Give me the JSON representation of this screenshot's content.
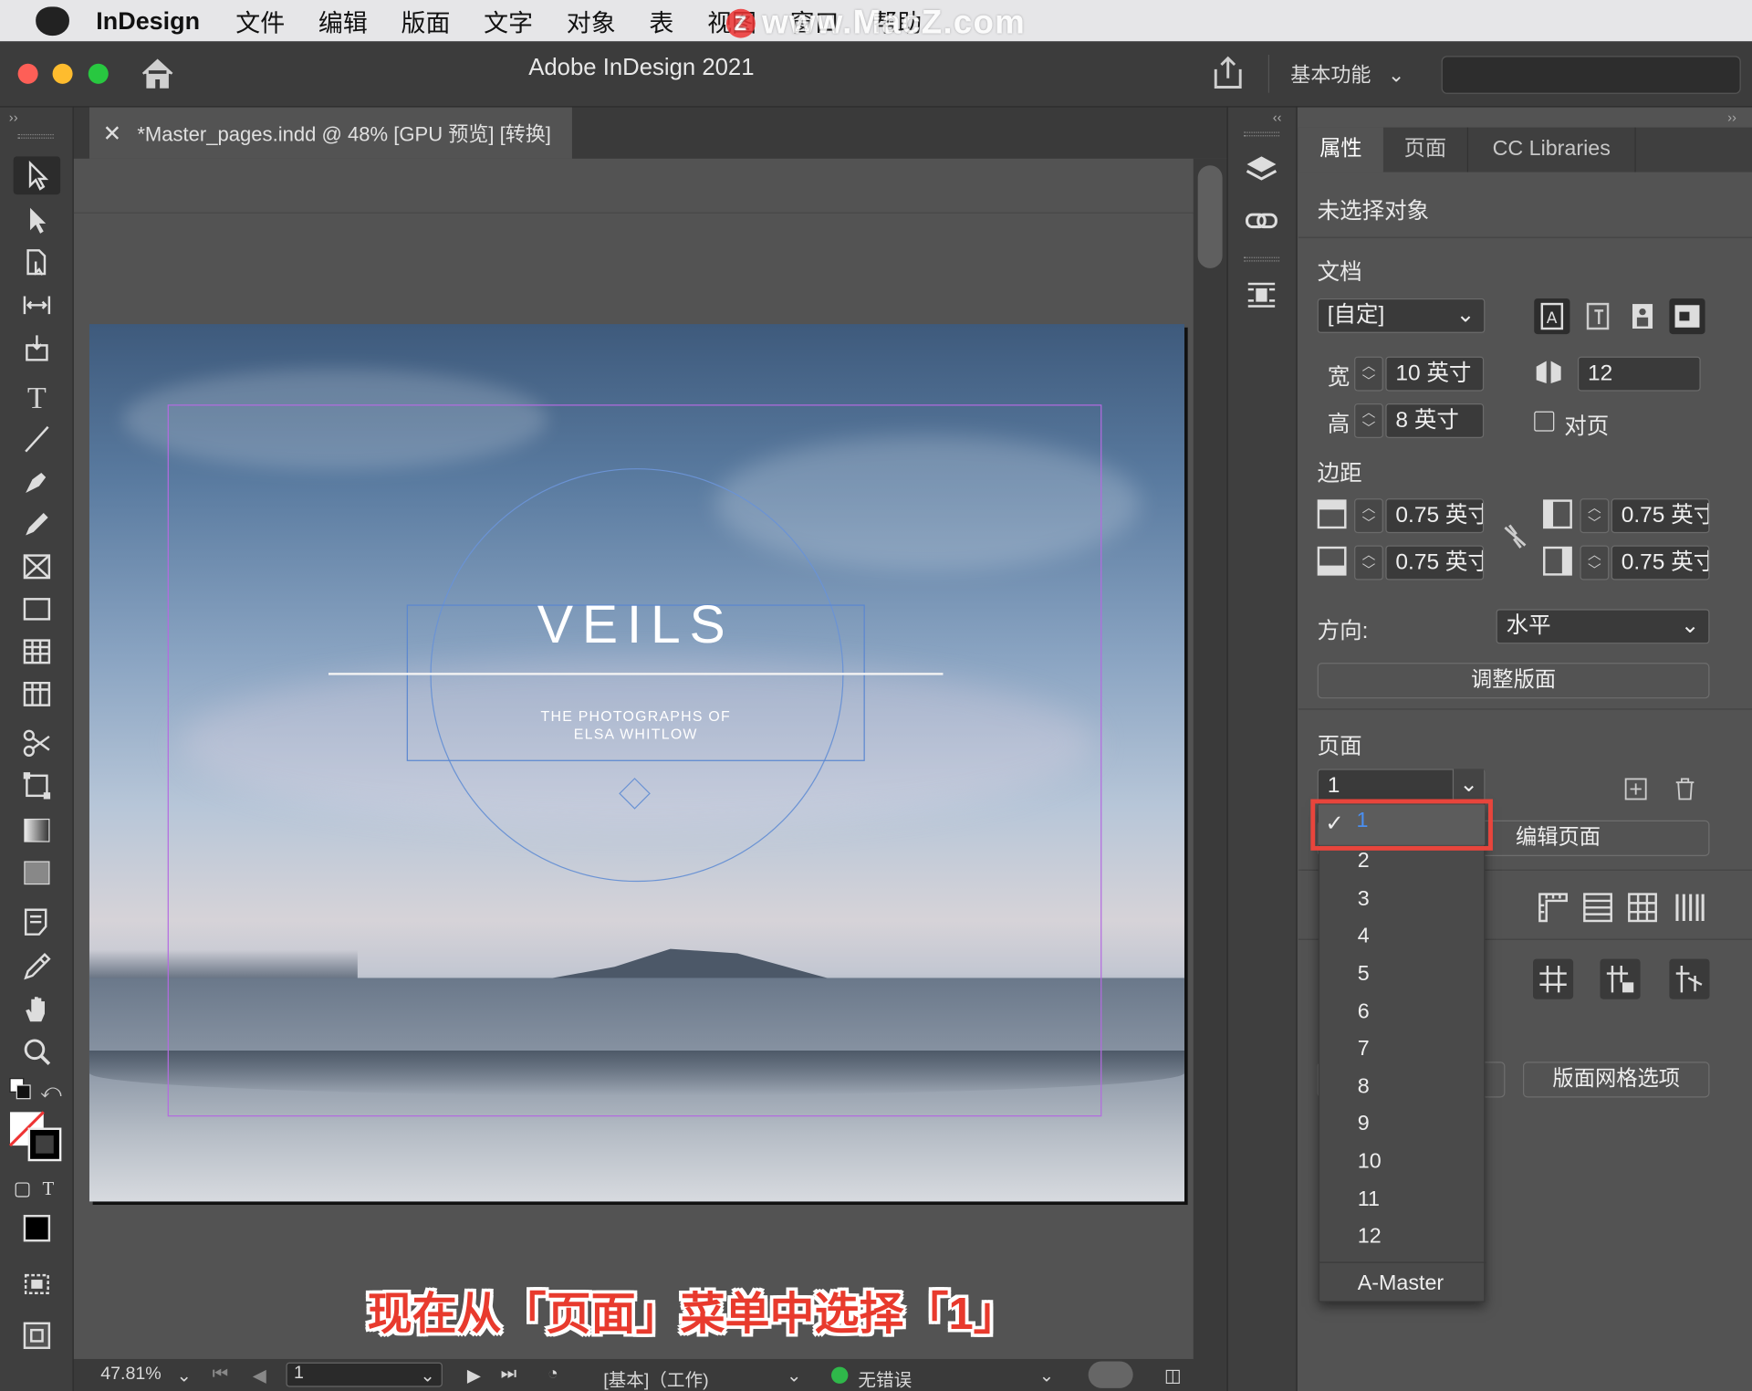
{
  "menubar": {
    "app": "InDesign",
    "items": [
      "文件",
      "编辑",
      "版面",
      "文字",
      "对象",
      "表",
      "视图",
      "窗口",
      "帮助"
    ],
    "watermark": "www.MacZ.com"
  },
  "window": {
    "title": "Adobe InDesign 2021",
    "workspace": "基本功能"
  },
  "document": {
    "tab_title": "*Master_pages.indd @ 48% [GPU 预览] [转换]",
    "headline": "VEILS",
    "subtitle_line1": "THE PHOTOGRAPHS OF",
    "subtitle_line2": "ELSA WHITLOW"
  },
  "caption": "现在从「页面」菜单中选择「1」",
  "statusbar": {
    "zoom": "47.81%",
    "page": "1",
    "profile": "[基本]（工作)",
    "errors": "无错误",
    "ok_color": "#2fb84a"
  },
  "panel": {
    "tabs": [
      "属性",
      "页面",
      "CC Libraries"
    ],
    "no_selection": "未选择对象",
    "document_section": "文档",
    "preset": "[自定]",
    "width_label": "宽",
    "width_value": "10 英寸",
    "height_label": "高",
    "height_value": "8 英寸",
    "pages_count": "12",
    "facing_pages": "对页",
    "margins_section": "边距",
    "margin_top": "0.75 英寸",
    "margin_bottom": "0.75 英寸",
    "margin_left": "0.75 英寸",
    "margin_right": "0.75 英寸",
    "orientation_label": "方向:",
    "orientation_value": "水平",
    "adjust_layout": "调整版面",
    "page_section": "页面",
    "page_value": "1",
    "edit_page": "编辑页面",
    "layout_grid_options": "版面网格选项"
  },
  "page_dropdown": {
    "options": [
      "1",
      "2",
      "3",
      "4",
      "5",
      "6",
      "7",
      "8",
      "9",
      "10",
      "11",
      "12",
      "A-Master"
    ],
    "selected": "1",
    "highlight_color": "#e8453c",
    "selected_color": "#4a8ff0"
  }
}
